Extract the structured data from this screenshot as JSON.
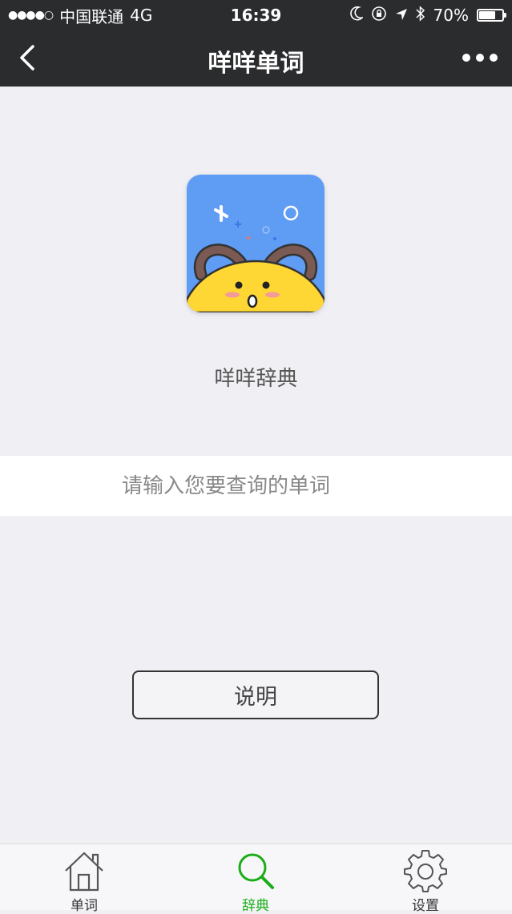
{
  "status_bar": {
    "carrier": "中国联通",
    "network": "4G",
    "time": "16:39",
    "battery": "70%",
    "battery_level": 0.7
  },
  "nav": {
    "title": "咩咩单词"
  },
  "app": {
    "name": "咩咩辞典"
  },
  "search": {
    "placeholder": "请输入您要查询的单词",
    "value": ""
  },
  "explain_button": {
    "label": "说明"
  },
  "tabs": [
    {
      "label": "单词",
      "icon": "home-icon",
      "active": false
    },
    {
      "label": "辞典",
      "icon": "search-icon",
      "active": true
    },
    {
      "label": "设置",
      "icon": "gear-icon",
      "active": false
    }
  ],
  "colors": {
    "nav_bg": "#2b2c2e",
    "page_bg": "#efeff4",
    "accent": "#1aad19",
    "logo_blue": "#5f9cf4",
    "logo_yellow": "#ffd735",
    "horn": "#7a5a52"
  }
}
